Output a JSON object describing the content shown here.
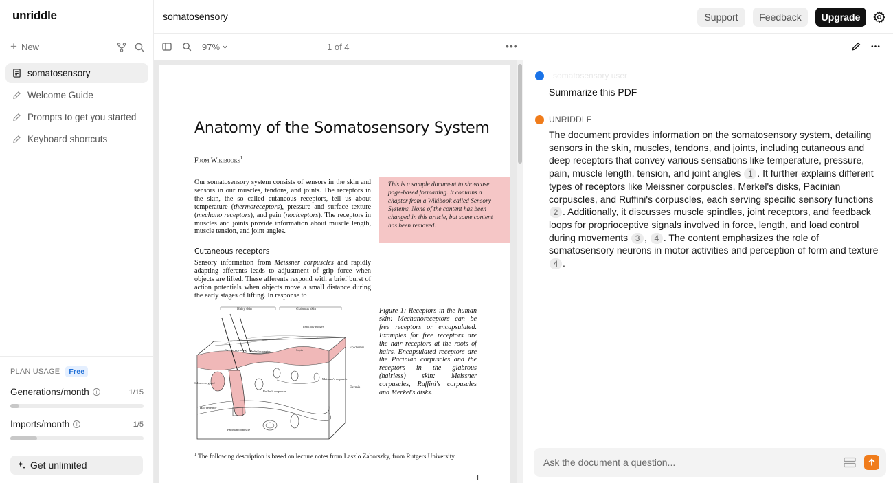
{
  "sidebar": {
    "logo": "unriddle",
    "new_label": "New",
    "items": [
      {
        "label": "somatosensory",
        "icon": "document-icon",
        "active": true
      },
      {
        "label": "Welcome Guide",
        "icon": "pencil-icon"
      },
      {
        "label": "Prompts to get you started",
        "icon": "pencil-icon"
      },
      {
        "label": "Keyboard shortcuts",
        "icon": "pencil-icon"
      }
    ],
    "plan_label": "PLAN USAGE",
    "plan_badge": "Free",
    "generations": {
      "label": "Generations/month",
      "count": "1/15",
      "fraction": 0.067
    },
    "imports": {
      "label": "Imports/month",
      "count": "1/5",
      "fraction": 0.2
    },
    "get_unlimited": "Get unlimited"
  },
  "header": {
    "doc_title": "somatosensory",
    "support": "Support",
    "feedback": "Feedback",
    "upgrade": "Upgrade"
  },
  "viewer": {
    "zoom": "97%",
    "pages": "1 of 4",
    "page": {
      "title": "Anatomy of the Somatosensory System",
      "from": "From Wikibooks",
      "from_sup": "1",
      "intro": "Our somatosensory system consists of sensors in the skin and sensors in our muscles, tendons, and joints. The receptors in the skin, the so called cutaneous receptors, tell us about temperature (thermoreceptors), pressure and surface texture (mechano receptors), and pain (nociceptors). The receptors in muscles and joints provide information about muscle length, muscle tension, and joint angles.",
      "note": "This is a sample document to showcase page-based formatting. It contains a chapter from a Wikibook called Sensory Systems. None of the content has been changed in this article, but some content has been removed.",
      "section": "Cutaneous receptors",
      "section_text": "Sensory information from Meissner corpuscles and rapidly adapting afferents leads to adjustment of grip force when objects are lifted. These afferents respond with a brief burst of action potentials when objects move a small distance during the early stages of lifting. In response to",
      "caption": "Figure 1: Receptors in the human skin: Mechanoreceptors can be free receptors or encapsulated. Examples for free receptors are the hair receptors at the roots of hairs. Encapsulated receptors are the Pacinian corpuscles and the receptors in the glabrous (hairless) skin: Meissner corpuscles, Ruffini's corpuscles and Merkel's disks.",
      "figure_labels": {
        "hairy": "Hairy skin",
        "glabrous": "Glabrous skin",
        "papillary": "Papillary Ridges",
        "epidermis": "Epidermis",
        "dermis": "Dermis",
        "free_nerve": "Free nerve ending",
        "merkel": "Merkel's receptor",
        "septa": "Septa",
        "sebaceous": "Sebaceous gland",
        "ruffini": "Ruffini's corpuscle",
        "meissner": "Meissner's corpuscle",
        "hair_receptor": "Hair receptor",
        "pacinian": "Pacinian corpuscle"
      },
      "footnote_sup": "1",
      "footnote": "The following description is based on lecture notes from Laszlo Zaborszky, from Rutgers University.",
      "page_number": "1"
    }
  },
  "chat": {
    "user_name": "somatosensory user",
    "user_message": "Summarize this PDF",
    "ai_name": "UNRIDDLE",
    "ai_parts": {
      "p1": "The document provides information on the somatosensory system, detailing sensors in the skin, muscles, tendons, and joints, including cutaneous and deep receptors that convey various sensations like temperature, pressure, pain, muscle length, tension, and joint angles",
      "c1": "1",
      "p2": ". It further explains different types of receptors like Meissner corpuscles, Merkel's disks, Pacinian corpuscles, and Ruffini's corpuscles, each serving specific sensory functions",
      "c2": "2",
      "p3": ". Additionally, it discusses muscle spindles, joint receptors, and feedback loops for proprioceptive signals involved in force, length, and load control during movements",
      "c3": "3",
      "sep": ",",
      "c4": "4",
      "p4": ". The content emphasizes the role of somatosensory neurons in motor activities and perception of form and texture",
      "c5": "4",
      "p5": "."
    },
    "ask_placeholder": "Ask the document a question..."
  },
  "colors": {
    "accent_orange": "#f07c1b",
    "user_blue": "#1a73e8",
    "badge_blue": "#1f6fd6",
    "note_pink": "#f5c6c6"
  }
}
